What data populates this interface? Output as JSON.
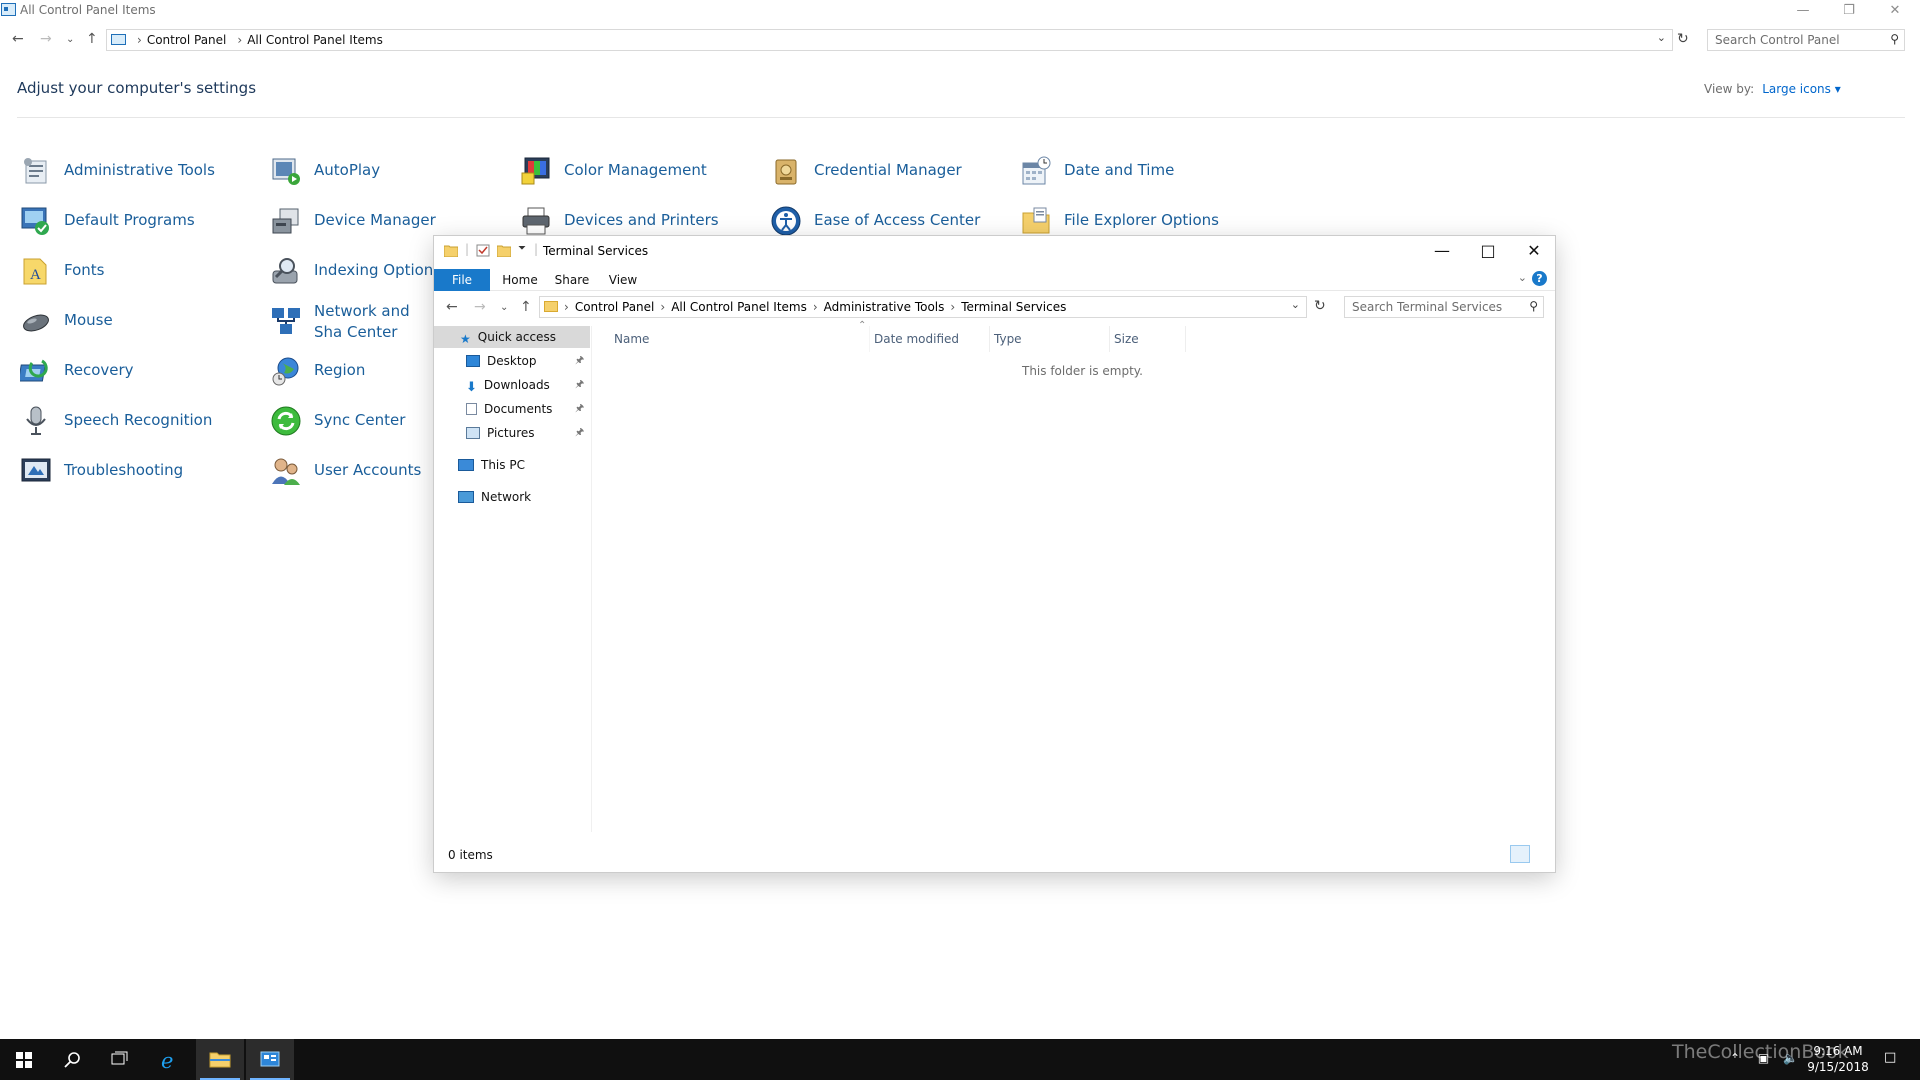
{
  "control_panel": {
    "window_title": "All Control Panel Items",
    "breadcrumb": [
      "Control Panel",
      "All Control Panel Items"
    ],
    "search_placeholder": "Search Control Panel",
    "heading": "Adjust your computer's settings",
    "view_by_label": "View by:",
    "view_by_value": "Large icons",
    "items": [
      {
        "label": "Administrative Tools",
        "icon": "administrative-tools-icon"
      },
      {
        "label": "AutoPlay",
        "icon": "autoplay-icon"
      },
      {
        "label": "Color Management",
        "icon": "color-management-icon"
      },
      {
        "label": "Credential Manager",
        "icon": "credential-manager-icon"
      },
      {
        "label": "Date and Time",
        "icon": "date-and-time-icon"
      },
      {
        "label": "Default Programs",
        "icon": "default-programs-icon"
      },
      {
        "label": "Device Manager",
        "icon": "device-manager-icon"
      },
      {
        "label": "Devices and Printers",
        "icon": "devices-and-printers-icon"
      },
      {
        "label": "Ease of Access Center",
        "icon": "ease-of-access-icon"
      },
      {
        "label": "File Explorer Options",
        "icon": "file-explorer-options-icon"
      },
      {
        "label": "Fonts",
        "icon": "fonts-icon"
      },
      {
        "label": "Indexing Options",
        "icon": "indexing-options-icon"
      },
      {
        "label": "Mouse",
        "icon": "mouse-icon"
      },
      {
        "label": "Network and Sha Center",
        "icon": "network-sharing-icon"
      },
      {
        "label": "Recovery",
        "icon": "recovery-icon"
      },
      {
        "label": "Region",
        "icon": "region-icon"
      },
      {
        "label": "Speech Recognition",
        "icon": "speech-recognition-icon"
      },
      {
        "label": "Sync Center",
        "icon": "sync-center-icon"
      },
      {
        "label": "Troubleshooting",
        "icon": "troubleshooting-icon"
      },
      {
        "label": "User Accounts",
        "icon": "user-accounts-icon"
      }
    ]
  },
  "explorer": {
    "window_title": "Terminal Services",
    "ribbon_tabs": [
      "File",
      "Home",
      "Share",
      "View"
    ],
    "breadcrumb": [
      "Control Panel",
      "All Control Panel Items",
      "Administrative Tools",
      "Terminal Services"
    ],
    "search_placeholder": "Search Terminal Services",
    "nav_pane": {
      "quick_access": "Quick access",
      "pinned": [
        "Desktop",
        "Downloads",
        "Documents",
        "Pictures"
      ],
      "this_pc": "This PC",
      "network": "Network"
    },
    "columns": [
      "Name",
      "Date modified",
      "Type",
      "Size"
    ],
    "empty_message": "This folder is empty.",
    "status": "0 items"
  },
  "taskbar": {
    "time": "9:16 AM",
    "date": "9/15/2018",
    "watermark": "TheCollectionBook"
  },
  "colors": {
    "link_blue": "#1a5e9a",
    "accent_blue": "#1979ca",
    "taskbar_bg": "#101010"
  }
}
